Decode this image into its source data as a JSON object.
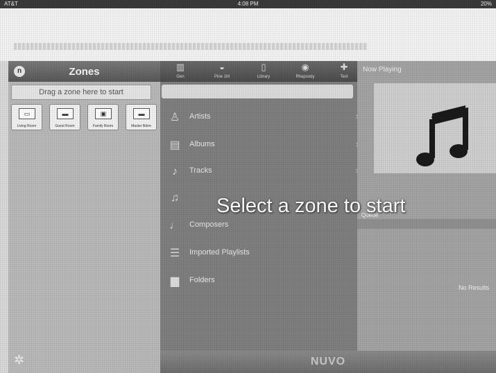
{
  "status_bar": {
    "carrier": "AT&T",
    "time": "4:08 PM",
    "battery": "20%"
  },
  "zones": {
    "title": "Zones",
    "drag_hint": "Drag a zone here to start",
    "tiles": [
      {
        "label": "Living Room"
      },
      {
        "label": "Guest Room"
      },
      {
        "label": "Family Room"
      },
      {
        "label": "Master Bdrm"
      }
    ]
  },
  "library": {
    "tabs": [
      {
        "label": "Gen"
      },
      {
        "label": "Pine 1M"
      },
      {
        "label": "Library"
      },
      {
        "label": "Rhapsody"
      },
      {
        "label": "Text"
      }
    ],
    "items": [
      {
        "label": "Artists",
        "icon": "artist-icon"
      },
      {
        "label": "Albums",
        "icon": "album-icon"
      },
      {
        "label": "Tracks",
        "icon": "music-note-icon"
      },
      {
        "label": "",
        "icon": "genre-icon"
      },
      {
        "label": "Composers",
        "icon": "composer-icon"
      },
      {
        "label": "Imported Playlists",
        "icon": "playlist-icon"
      },
      {
        "label": "Folders",
        "icon": "folder-icon"
      }
    ]
  },
  "now_playing": {
    "title": "Now Playing",
    "queue_label": "Queue",
    "no_results": "No Results"
  },
  "overlay_message": "Select a zone to start",
  "brand": "NUVO"
}
